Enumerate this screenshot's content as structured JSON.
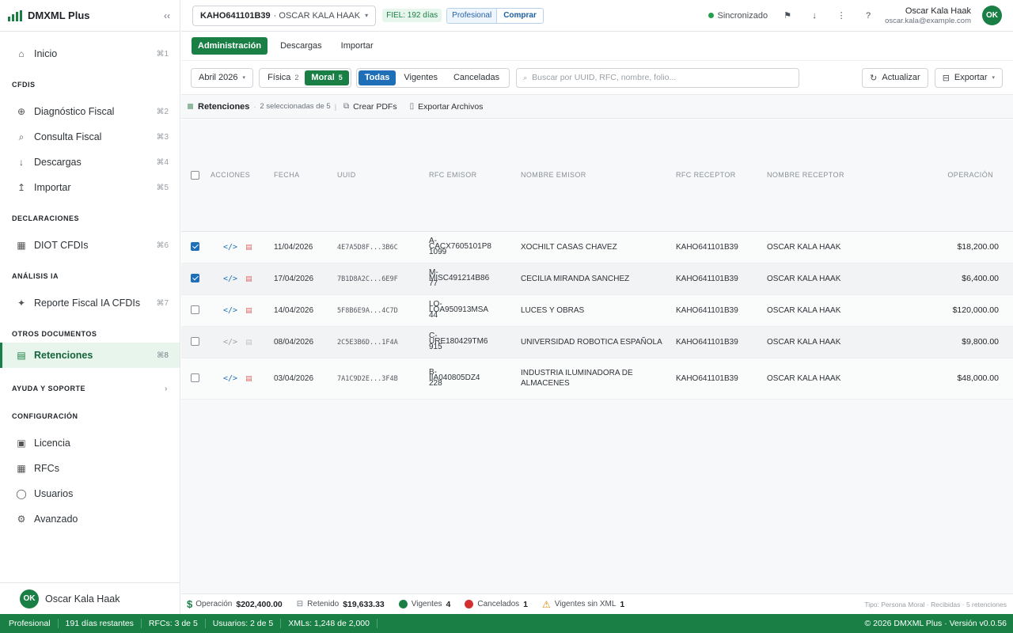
{
  "sidebar": {
    "brand": "DMXML Plus",
    "collapse_icon": "‹‹",
    "home": {
      "label": "Inicio",
      "shortcut": "⌘1"
    },
    "sections": [
      {
        "title": "CFDIS",
        "items": [
          {
            "label": "Diagnóstico Fiscal",
            "shortcut": "⌘2"
          },
          {
            "label": "Consulta Fiscal",
            "shortcut": "⌘3"
          },
          {
            "label": "Descargas",
            "shortcut": "⌘4"
          },
          {
            "label": "Importar",
            "shortcut": "⌘5"
          }
        ]
      },
      {
        "title": "DECLARACIONES",
        "items": [
          {
            "label": "DIOT CFDIs",
            "shortcut": "⌘6"
          }
        ]
      },
      {
        "title": "ANÁLISIS IA",
        "items": [
          {
            "label": "Reporte Fiscal IA CFDIs",
            "shortcut": "⌘7"
          }
        ]
      },
      {
        "title": "OTROS DOCUMENTOS",
        "items": [
          {
            "label": "Retenciones",
            "shortcut": "⌘8"
          }
        ]
      },
      {
        "title": "AYUDA Y SOPORTE",
        "items": []
      },
      {
        "title": "CONFIGURACIÓN",
        "items": [
          {
            "label": "Licencia"
          },
          {
            "label": "RFCs"
          },
          {
            "label": "Usuarios"
          },
          {
            "label": "Avanzado"
          }
        ]
      }
    ],
    "user": {
      "initials": "OK",
      "name": "Oscar Kala Haak"
    }
  },
  "topbar": {
    "rfc": "KAHO641101B39",
    "rfc_name": "· OSCAR KALA HAAK",
    "fiel": "FIEL: 192 días",
    "plan": "Profesional",
    "buy": "Comprar",
    "sync": "Sincronizado",
    "user_name": "Oscar Kala Haak",
    "user_email": "oscar.kala@example.com",
    "user_initials": "OK"
  },
  "subtabs": [
    "Administración",
    "Descargas",
    "Importar"
  ],
  "filters": {
    "month": "Abril 2026",
    "persona": [
      {
        "label": "Física",
        "count": "2"
      },
      {
        "label": "Moral",
        "count": "5"
      }
    ],
    "status": [
      "Todas",
      "Vigentes",
      "Canceladas"
    ],
    "search_placeholder": "Buscar por UUID, RFC, nombre, folio...",
    "refresh": "Actualizar",
    "export": "Exportar"
  },
  "section": {
    "title": "Retenciones",
    "selected": "2 seleccionadas de 5",
    "create_pdfs": "Crear PDFs",
    "export_files": "Exportar Archivos"
  },
  "table": {
    "headers": [
      "ACCIONES",
      "FECHA",
      "UUID",
      "RFC EMISOR",
      "NOMBRE EMISOR",
      "RFC RECEPTOR",
      "NOMBRE RECEPTOR",
      "OPERACIÓN"
    ],
    "rows": [
      {
        "checked": true,
        "fecha": "11/04/2026",
        "uuid": "4E7A5D8F...3B6C",
        "rfc_top": "A-",
        "rfc_mid": "CACX7605101P8",
        "rfc_bot": "1099",
        "nombre_emisor": "XOCHILT CASAS CHAVEZ",
        "rfc_receptor": "KAHO641101B39",
        "nombre_receptor": "OSCAR KALA HAAK",
        "operacion": "$18,200.00"
      },
      {
        "checked": true,
        "fecha": "17/04/2026",
        "uuid": "7B1D8A2C...6E9F",
        "rfc_top": "M-",
        "rfc_mid": "MISC491214B86",
        "rfc_bot": "77",
        "nombre_emisor": "CECILIA MIRANDA SANCHEZ",
        "rfc_receptor": "KAHO641101B39",
        "nombre_receptor": "OSCAR KALA HAAK",
        "operacion": "$6,400.00"
      },
      {
        "checked": false,
        "fecha": "14/04/2026",
        "uuid": "5F8B6E9A...4C7D",
        "rfc_top": "LO-",
        "rfc_mid": "LOA950913MSA",
        "rfc_bot": "44",
        "nombre_emisor": "LUCES Y OBRAS",
        "rfc_receptor": "KAHO641101B39",
        "nombre_receptor": "OSCAR KALA HAAK",
        "operacion": "$120,000.00"
      },
      {
        "checked": false,
        "fecha": "08/04/2026",
        "uuid": "2C5E3B6D...1F4A",
        "rfc_top": "C-",
        "rfc_mid": "URE180429TM6",
        "rfc_bot": "915",
        "nombre_emisor": "UNIVERSIDAD ROBOTICA ESPAÑOLA",
        "rfc_receptor": "KAHO641101B39",
        "nombre_receptor": "OSCAR KALA HAAK",
        "operacion": "$9,800.00",
        "dim": true
      },
      {
        "checked": false,
        "fecha": "03/04/2026",
        "uuid": "7A1C9D2E...3F4B",
        "rfc_top": "B-",
        "rfc_mid": "IIA040805DZ4",
        "rfc_bot": "228",
        "nombre_emisor": "INDUSTRIA ILUMINADORA DE ALMACENES",
        "rfc_receptor": "KAHO641101B39",
        "nombre_receptor": "OSCAR KALA HAAK",
        "operacion": "$48,000.00"
      }
    ]
  },
  "summary": {
    "operacion_label": "Operación",
    "operacion_value": "$202,400.00",
    "retenido_label": "Retenido",
    "retenido_value": "$19,633.33",
    "vigentes_label": "Vigentes",
    "vigentes_value": "4",
    "cancelados_label": "Cancelados",
    "cancelados_value": "1",
    "sinxml_label": "Vigentes sin XML",
    "sinxml_value": "1",
    "meta": "Tipo: Persona Moral · Recibidas · 5 retenciones",
    "colors": {
      "vigentes": "#1a7f45",
      "cancelados": "#d32f2f",
      "warning": "#d48806"
    }
  },
  "statusbar": {
    "items": [
      "Profesional",
      "191 días restantes",
      "RFCs: 3 de 5",
      "Usuarios: 2 de 5",
      "XMLs: 1,248 de 2,000"
    ],
    "copyright": "© 2026 DMXML Plus · Versión v0.0.56"
  },
  "colors": {
    "brand_green": "#1a7f45",
    "accent_blue": "#1f6fb8"
  }
}
